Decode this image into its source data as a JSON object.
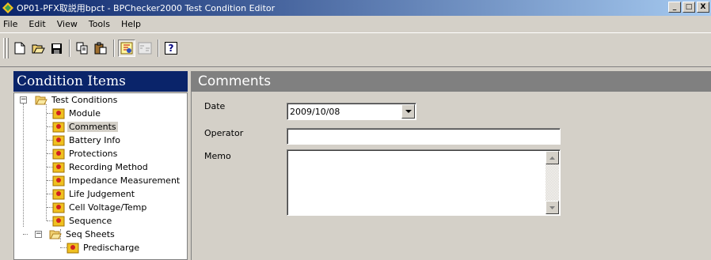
{
  "window": {
    "title": "OP01-PFX取説用bpct - BPChecker2000 Test Condition Editor",
    "controls": [
      "_",
      "□",
      "X"
    ]
  },
  "menu": [
    "File",
    "Edit",
    "View",
    "Tools",
    "Help"
  ],
  "toolbar": {
    "buttons": [
      "new-icon",
      "open-icon",
      "save-icon",
      "copy-icon",
      "paste-icon",
      "edit-condition-icon",
      "result-icon",
      "help-icon"
    ],
    "help_label": "?"
  },
  "left_pane": {
    "title": "Condition Items",
    "tree": {
      "root": "Test Conditions",
      "items": [
        "Module",
        "Comments",
        "Battery Info",
        "Protections",
        "Recording Method",
        "Impedance Measurement",
        "Life Judgement",
        "Cell Voltage/Temp",
        "Sequence"
      ],
      "folder": "Seq Sheets",
      "folder_items": [
        "Predischarge"
      ],
      "selected": "Comments",
      "expander_collapse": "−"
    }
  },
  "right_pane": {
    "title": "Comments",
    "date_label": "Date",
    "date_value": "2009/10/08",
    "operator_label": "Operator",
    "operator_value": "",
    "memo_label": "Memo",
    "memo_value": ""
  }
}
